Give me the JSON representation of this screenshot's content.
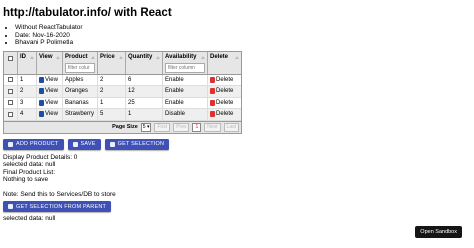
{
  "header": {
    "title": "http://tabulator.info/ with React"
  },
  "meta": [
    "Without ReactTabulator",
    "Date: Nov-16-2020",
    "Bhavani P Polimetla"
  ],
  "table": {
    "columns": [
      "ID",
      "View",
      "Product",
      "Price",
      "Quantity",
      "Availability",
      "Delete"
    ],
    "filters": {
      "product": "filter colur",
      "availability": "filter column"
    },
    "rows": [
      {
        "id": "1",
        "view": "View",
        "product": "Apples",
        "price": "2",
        "quantity": "6",
        "availability": "Enable",
        "delete": "Delete"
      },
      {
        "id": "2",
        "view": "View",
        "product": "Oranges",
        "price": "2",
        "quantity": "12",
        "availability": "Enable",
        "delete": "Delete"
      },
      {
        "id": "3",
        "view": "View",
        "product": "Bananas",
        "price": "1",
        "quantity": "25",
        "availability": "Enable",
        "delete": "Delete"
      },
      {
        "id": "4",
        "view": "View",
        "product": "Strawberry",
        "price": "5",
        "quantity": "1",
        "availability": "Disable",
        "delete": "Delete"
      }
    ],
    "footer": {
      "page_size_label": "Page Size",
      "page_size": "5",
      "first": "First",
      "prev": "Prev",
      "page": "1",
      "next": "Next",
      "last": "Last"
    }
  },
  "buttons": {
    "add": "ADD PRODUCT",
    "save": "SAVE",
    "get": "GET SELECTION",
    "get_parent": "GET SELECTION FROM PARENT"
  },
  "status": {
    "display": "Display Product Details: 0",
    "selected": "selected data: null",
    "final": "Final Product List:",
    "nothing": "Nothing to save",
    "note": "Note: Send this to Services/DB to store",
    "selected2": "selected data: null"
  },
  "sandbox": "Open Sandbox"
}
